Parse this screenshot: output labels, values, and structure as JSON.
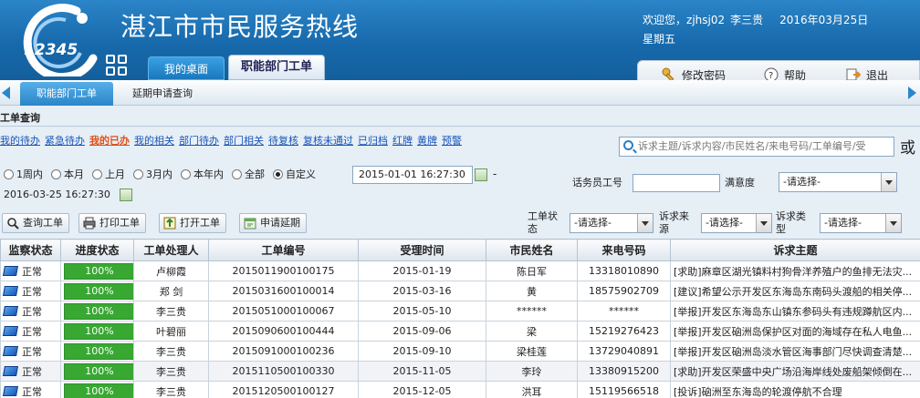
{
  "header": {
    "logo_text": "12345",
    "title": "湛江市市民服务热线",
    "welcome": "欢迎您，",
    "username": "zjhsj02",
    "realname": "李三贵",
    "date": "2016年03月25日",
    "weekday": "星期五"
  },
  "top_tabs": [
    "我的桌面",
    "职能部门工单"
  ],
  "utilities": [
    "修改密码",
    "帮助",
    "退出"
  ],
  "sub_tabs": [
    "职能部门工单",
    "延期申请查询"
  ],
  "panel": {
    "title": "工单查询",
    "filters": [
      "我的待办",
      "紧急待办",
      "我的已办",
      "我的相关",
      "部门待办",
      "部门相关",
      "待复核",
      "复核未通过",
      "已归档",
      "红牌",
      "黄牌",
      "预警"
    ],
    "selected_filter": "我的已办",
    "search_placeholder": "诉求主题/诉求内容/市民姓名/来电号码/工单编号/受",
    "or_text": "或",
    "time_options": [
      "1周内",
      "本月",
      "上月",
      "3月内",
      "本年内",
      "全部",
      "自定义"
    ],
    "selected_time": "自定义",
    "date_from": "2015-01-01 16:27:30",
    "date_sep": "-",
    "date_to": "2016-03-25 16:27:30",
    "operator_label": "话务员工号",
    "operator_value": "",
    "satisfaction_label": "满意度",
    "please_select": "-请选择-",
    "status_label": "工单状态",
    "source_label": "诉求来源",
    "type_label": "诉求类型",
    "buttons": [
      "查询工单",
      "打印工单",
      "打开工单",
      "申请延期"
    ]
  },
  "table": {
    "columns": [
      "监察状态",
      "进度状态",
      "工单处理人",
      "工单编号",
      "受理时间",
      "市民姓名",
      "来电号码",
      "诉求主题"
    ],
    "rows": [
      {
        "status": "正常",
        "progress": "100%",
        "progress_pct": 100,
        "handler": "卢柳霞",
        "id": "2015011900100175",
        "time": "2015-01-19",
        "name": "陈日军",
        "phone": "13318010890",
        "subject": "[求助]麻章区湖光镇料村狗骨洋养殖户的鱼排无法灾..."
      },
      {
        "status": "正常",
        "progress": "100%",
        "progress_pct": 100,
        "handler": "郑 剑",
        "id": "2015031600100014",
        "time": "2015-03-16",
        "name": "黄",
        "phone": "18575902709",
        "subject": "[建议]希望公示开发区东海岛东南码头渡船的相关停..."
      },
      {
        "status": "正常",
        "progress": "100%",
        "progress_pct": 100,
        "handler": "李三贵",
        "id": "2015051000100067",
        "time": "2015-05-10",
        "name": "******",
        "phone": "******",
        "subject": "[举报]开发区东海岛东山镇东参码头有违规蹲航区内..."
      },
      {
        "status": "正常",
        "progress": "100%",
        "progress_pct": 100,
        "handler": "叶碧丽",
        "id": "2015090600100444",
        "time": "2015-09-06",
        "name": "梁",
        "phone": "15219276423",
        "subject": "[举报]开发区硇洲岛保护区对面的海域存在私人电鱼..."
      },
      {
        "status": "正常",
        "progress": "100%",
        "progress_pct": 100,
        "handler": "李三贵",
        "id": "2015091000100236",
        "time": "2015-09-10",
        "name": "梁桂莲",
        "phone": "13729040891",
        "subject": "[举报]开发区硇洲岛淡水管区海事部门尽快调查清楚..."
      },
      {
        "status": "正常",
        "progress": "100%",
        "progress_pct": 100,
        "handler": "李三贵",
        "id": "2015110500100330",
        "time": "2015-11-05",
        "name": "李玲",
        "phone": "13380915200",
        "subject": "[求助]开发区荣盛中央广场沿海岸线处废船架倾倒在..."
      },
      {
        "status": "正常",
        "progress": "100%",
        "progress_pct": 100,
        "handler": "李三贵",
        "id": "2015120500100127",
        "time": "2015-12-05",
        "name": "洪耳",
        "phone": "15119566518",
        "subject": "[投诉]硇洲至东海岛的轮渡停航不合理"
      }
    ]
  },
  "colors": {
    "header_blue": "#1769ab",
    "progress_green": "#3fb23a",
    "link_blue": "#1a56b8",
    "selected_orange": "#e0501a"
  },
  "icons": [
    "logo-icon",
    "grid-apps-icon",
    "key-icon",
    "help-icon",
    "exit-icon",
    "search-icon",
    "calendar-icon",
    "print-icon",
    "open-icon",
    "extend-icon",
    "ticket-status-icon"
  ]
}
